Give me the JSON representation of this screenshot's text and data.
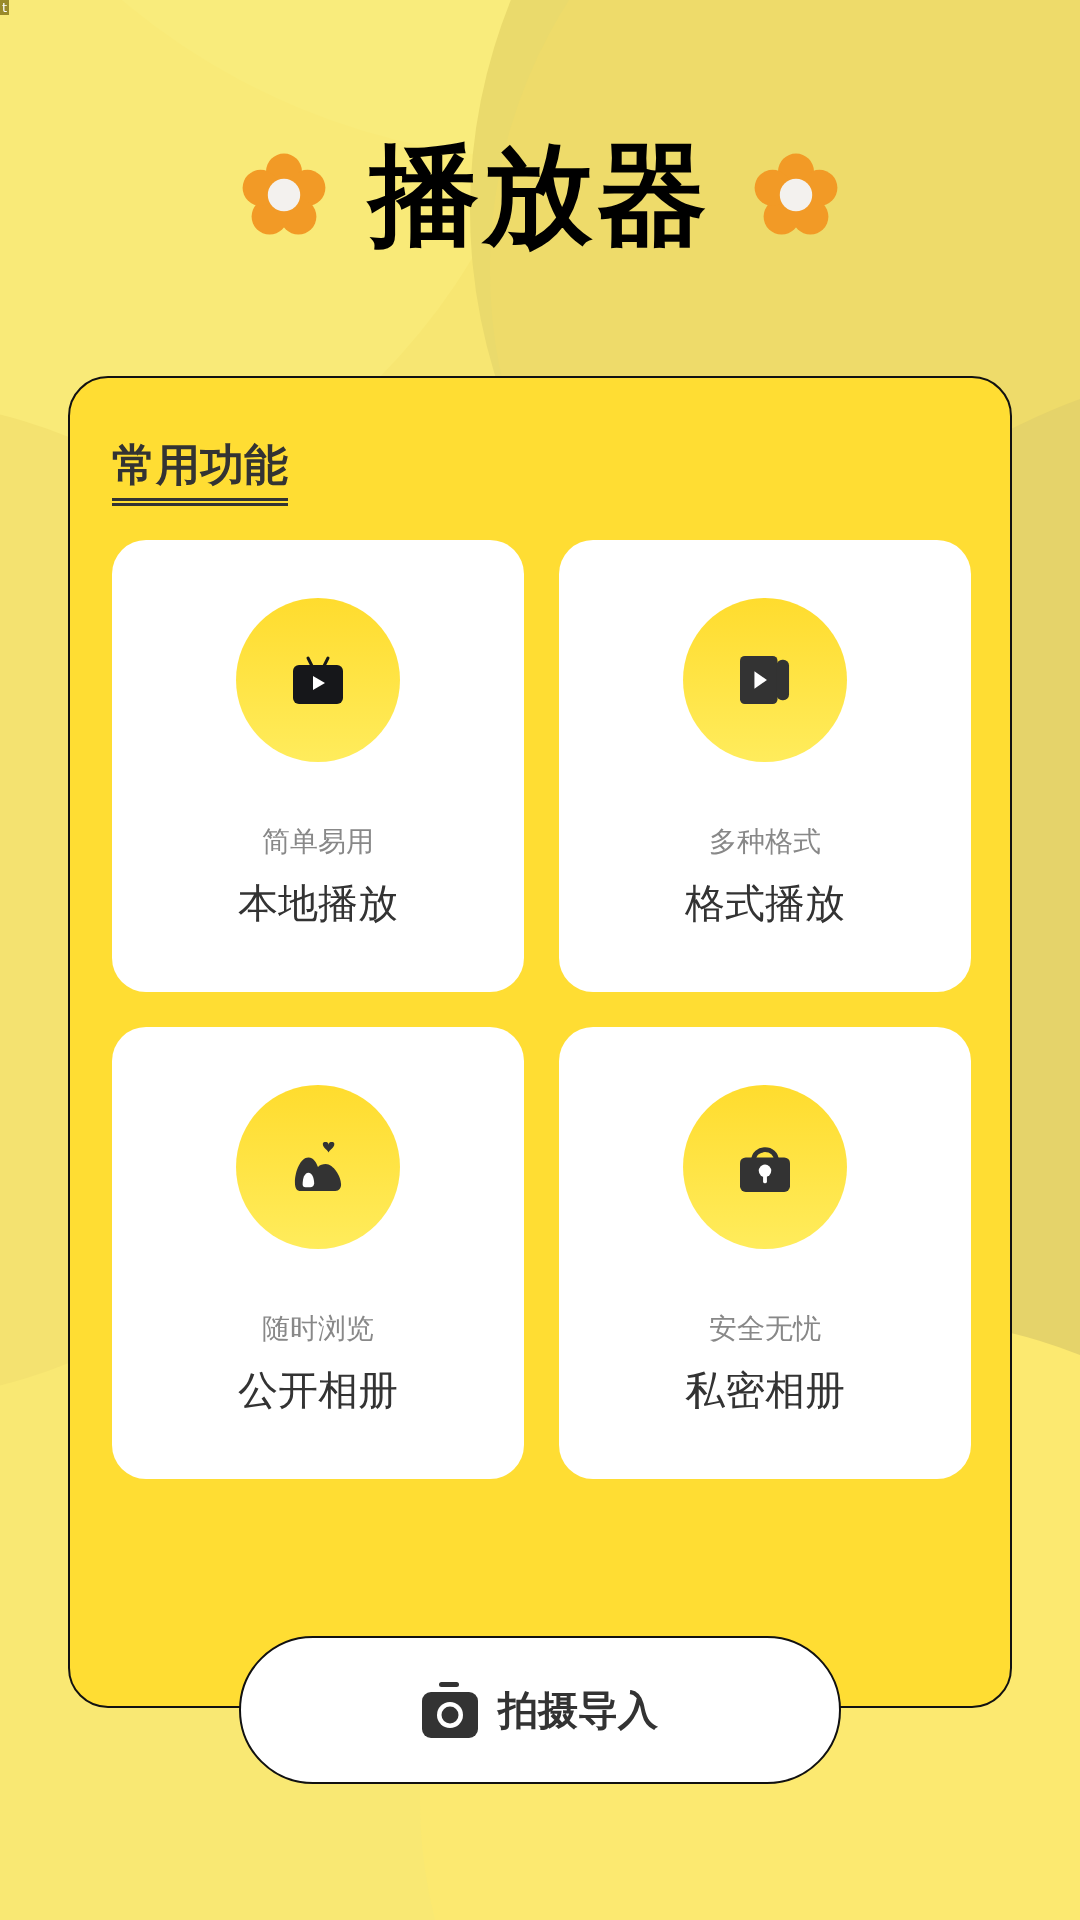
{
  "status_text": "t",
  "title": "播放器",
  "section": {
    "title": "常用功能"
  },
  "features": [
    {
      "kind": "tv",
      "subtitle": "简单易用",
      "title": "本地播放"
    },
    {
      "kind": "video",
      "subtitle": "多种格式",
      "title": "格式播放"
    },
    {
      "kind": "album",
      "subtitle": "随时浏览",
      "title": "公开相册"
    },
    {
      "kind": "lock",
      "subtitle": "安全无忧",
      "title": "私密相册"
    }
  ],
  "action_button": {
    "label": "拍摄导入"
  }
}
